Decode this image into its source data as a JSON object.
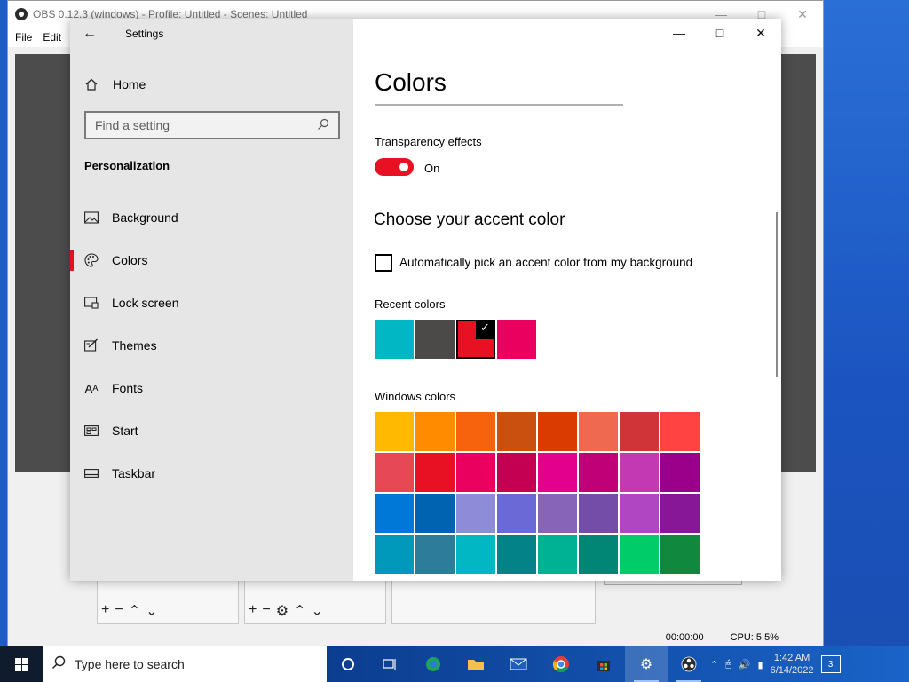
{
  "obs": {
    "title": "OBS 0.12.3 (windows) - Profile: Untitled - Scenes: Untitled",
    "menu": [
      "File",
      "Edit"
    ],
    "status": {
      "time": "00:00:00",
      "cpu": "CPU: 5.5%"
    }
  },
  "settings": {
    "window_title": "Settings",
    "home_label": "Home",
    "search_placeholder": "Find a setting",
    "section": "Personalization",
    "nav_items": [
      {
        "label": "Background",
        "icon": "picture-icon"
      },
      {
        "label": "Colors",
        "icon": "palette-icon",
        "active": true
      },
      {
        "label": "Lock screen",
        "icon": "lock-screen-icon"
      },
      {
        "label": "Themes",
        "icon": "themes-icon"
      },
      {
        "label": "Fonts",
        "icon": "fonts-icon"
      },
      {
        "label": "Start",
        "icon": "start-icon"
      },
      {
        "label": "Taskbar",
        "icon": "taskbar-icon"
      }
    ],
    "page_title": "Colors",
    "transparency": {
      "label": "Transparency effects",
      "state": "On",
      "enabled": true
    },
    "accent_heading": "Choose your accent color",
    "auto_pick_label": "Automatically pick an accent color from my background",
    "auto_pick_checked": false,
    "recent_label": "Recent colors",
    "recent_colors": [
      "#00b7c3",
      "#4c4a48",
      "#e81123",
      "#ea005e"
    ],
    "recent_selected_index": 2,
    "windows_label": "Windows colors",
    "windows_colors": [
      "#ffb900",
      "#ff8c00",
      "#f7630c",
      "#ca5010",
      "#da3b01",
      "#ef6950",
      "#d13438",
      "#ff4343",
      "#e74856",
      "#e81123",
      "#ea005e",
      "#c30052",
      "#e3008c",
      "#bf0077",
      "#c239b3",
      "#9a0089",
      "#0078d7",
      "#0063b1",
      "#8e8cd8",
      "#6b69d6",
      "#8764b8",
      "#744da9",
      "#b146c2",
      "#881798",
      "#0099bc",
      "#2d7d9a",
      "#00b7c3",
      "#038387",
      "#00b294",
      "#018574",
      "#00cc6a",
      "#10893e"
    ]
  },
  "taskbar": {
    "search_placeholder": "Type here to search",
    "clock_time": "1:42 AM",
    "clock_date": "6/14/2022",
    "notification_count": "3"
  }
}
